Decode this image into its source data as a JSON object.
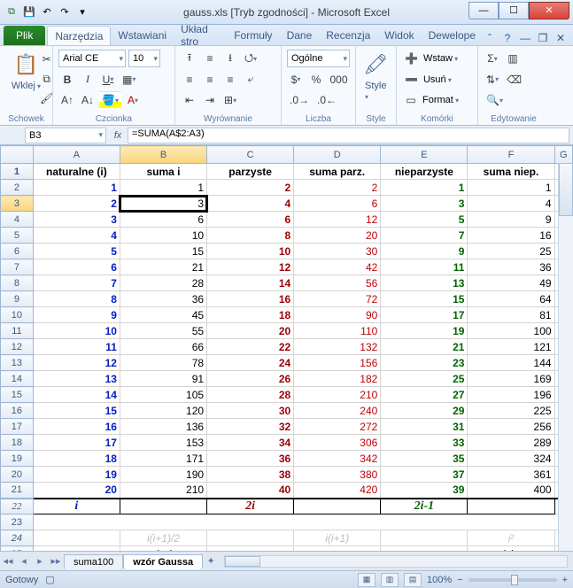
{
  "title": "gauss.xls  [Tryb zgodności]  -  Microsoft Excel",
  "qat": {
    "save": "💾",
    "undo": "↶",
    "redo": "↷",
    "down": "▾"
  },
  "tabs": {
    "file": "Plik",
    "items": [
      "Narzędzia",
      "Wstawiani",
      "Układ stro",
      "Formuły",
      "Dane",
      "Recenzja",
      "Widok",
      "Dewelope"
    ],
    "active_index": 0
  },
  "ribbon": {
    "clipboard": {
      "label": "Schowek",
      "paste": "Wklej"
    },
    "font": {
      "label": "Czcionka",
      "name": "Arial CE",
      "size": "10"
    },
    "align": {
      "label": "Wyrównanie"
    },
    "number": {
      "label": "Liczba",
      "format": "Ogólne"
    },
    "styles": {
      "label": "Style",
      "btn": "Style"
    },
    "cells": {
      "label": "Komórki",
      "insert": "Wstaw",
      "delete": "Usuń",
      "format": "Format"
    },
    "editing": {
      "label": "Edytowanie"
    }
  },
  "namebox": "B3",
  "formula": "=SUMA(A$2:A3)",
  "columns": [
    "A",
    "B",
    "C",
    "D",
    "E",
    "F",
    "G"
  ],
  "selected": {
    "col": "B",
    "row": 3
  },
  "headers": [
    "naturalne (i)",
    "suma i",
    "parzyste",
    "suma parz.",
    "nieparzyste",
    "suma niep."
  ],
  "rows": [
    {
      "r": 2,
      "a": 1,
      "b": 1,
      "c": 2,
      "d": 2,
      "e": 1,
      "f": 1
    },
    {
      "r": 3,
      "a": 2,
      "b": 3,
      "c": 4,
      "d": 6,
      "e": 3,
      "f": 4
    },
    {
      "r": 4,
      "a": 3,
      "b": 6,
      "c": 6,
      "d": 12,
      "e": 5,
      "f": 9
    },
    {
      "r": 5,
      "a": 4,
      "b": 10,
      "c": 8,
      "d": 20,
      "e": 7,
      "f": 16
    },
    {
      "r": 6,
      "a": 5,
      "b": 15,
      "c": 10,
      "d": 30,
      "e": 9,
      "f": 25
    },
    {
      "r": 7,
      "a": 6,
      "b": 21,
      "c": 12,
      "d": 42,
      "e": 11,
      "f": 36
    },
    {
      "r": 8,
      "a": 7,
      "b": 28,
      "c": 14,
      "d": 56,
      "e": 13,
      "f": 49
    },
    {
      "r": 9,
      "a": 8,
      "b": 36,
      "c": 16,
      "d": 72,
      "e": 15,
      "f": 64
    },
    {
      "r": 10,
      "a": 9,
      "b": 45,
      "c": 18,
      "d": 90,
      "e": 17,
      "f": 81
    },
    {
      "r": 11,
      "a": 10,
      "b": 55,
      "c": 20,
      "d": 110,
      "e": 19,
      "f": 100
    },
    {
      "r": 12,
      "a": 11,
      "b": 66,
      "c": 22,
      "d": 132,
      "e": 21,
      "f": 121
    },
    {
      "r": 13,
      "a": 12,
      "b": 78,
      "c": 24,
      "d": 156,
      "e": 23,
      "f": 144
    },
    {
      "r": 14,
      "a": 13,
      "b": 91,
      "c": 26,
      "d": 182,
      "e": 25,
      "f": 169
    },
    {
      "r": 15,
      "a": 14,
      "b": 105,
      "c": 28,
      "d": 210,
      "e": 27,
      "f": 196
    },
    {
      "r": 16,
      "a": 15,
      "b": 120,
      "c": 30,
      "d": 240,
      "e": 29,
      "f": 225
    },
    {
      "r": 17,
      "a": 16,
      "b": 136,
      "c": 32,
      "d": 272,
      "e": 31,
      "f": 256
    },
    {
      "r": 18,
      "a": 17,
      "b": 153,
      "c": 34,
      "d": 306,
      "e": 33,
      "f": 289
    },
    {
      "r": 19,
      "a": 18,
      "b": 171,
      "c": 36,
      "d": 342,
      "e": 35,
      "f": 324
    },
    {
      "r": 20,
      "a": 19,
      "b": 190,
      "c": 38,
      "d": 380,
      "e": 37,
      "f": 361
    },
    {
      "r": 21,
      "a": 20,
      "b": 210,
      "c": 40,
      "d": 420,
      "e": 39,
      "f": 400
    }
  ],
  "formula_row": {
    "r": 22,
    "a": "i",
    "c": "2i",
    "e": "2i-1"
  },
  "gray_row": {
    "r": 24,
    "b": "i(i+1)/2",
    "d": "i(i+1)",
    "f": "i²"
  },
  "note_row": {
    "r": 25,
    "b": "na końcu",
    "d": "potem",
    "f": "najpierw"
  },
  "blank_rows": [
    23
  ],
  "sheets": {
    "items": [
      "suma100",
      "wzór Gaussa"
    ],
    "active": 1,
    "nav": [
      "◂◂",
      "◂",
      "▸",
      "▸▸"
    ]
  },
  "status": {
    "ready": "Gotowy",
    "zoom": "100%",
    "minus": "−",
    "plus": "+"
  }
}
